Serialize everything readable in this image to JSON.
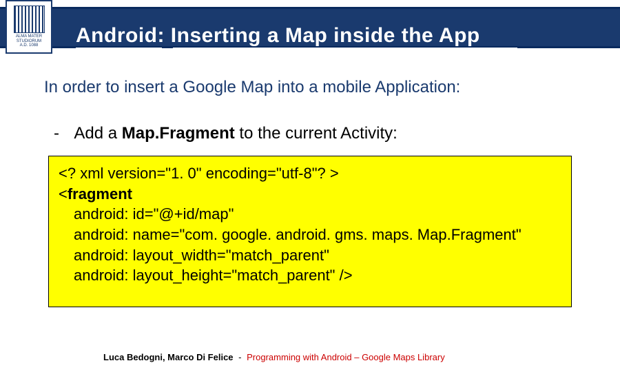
{
  "header": {
    "title_prefix": "Android:",
    "title_rest": " Inserting a Map inside the App",
    "logo_text_top": "ALMA MATER STUDIORUM",
    "logo_text_bottom": "A.D. 1088"
  },
  "intro": "In order to insert a Google Map into a mobile Application:",
  "bullet": {
    "dash": "-",
    "pre": "Add a ",
    "bold": "Map.Fragment",
    "post": " to the current Activity:"
  },
  "code": {
    "l1": "<? xml version=\"1. 0\" encoding=\"utf-8\"? >",
    "l2a": "<",
    "l2b": "fragment",
    "l3": "android: id=\"@+id/map\"",
    "l4": "android: name=\"com. google. android. gms. maps. Map.Fragment\"",
    "l5": "android: layout_width=\"match_parent\"",
    "l6": "android: layout_height=\"match_parent\" />"
  },
  "footer": {
    "authors": "Luca Bedogni, Marco Di Felice",
    "sep": "-",
    "course_main": "Programming with Android",
    "course_sub": " – Google Maps Library"
  }
}
